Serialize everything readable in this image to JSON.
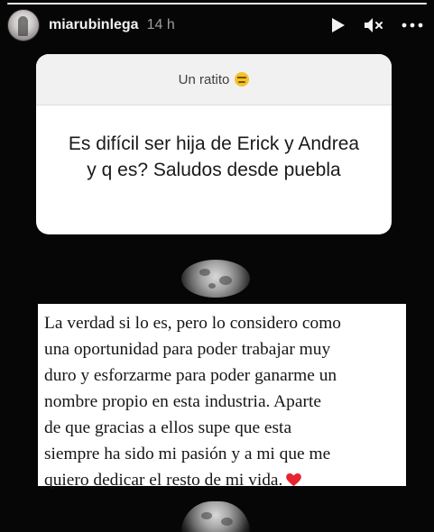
{
  "story": {
    "username": "miarubinlega",
    "time": "14 h",
    "progress": 1.0
  },
  "header": {
    "icons": [
      "play-icon",
      "mute-icon",
      "more-icon"
    ]
  },
  "question_sticker": {
    "prompt": "Un ratito",
    "prompt_emoji": "grimacing-face-emoji",
    "question": "Es difícil ser hija de Erick y Andrea y q es? Saludos desde puebla"
  },
  "answer": {
    "text": "La verdad si lo es, pero lo considero como\nuna oportunidad para poder trabajar muy\nduro y esforzarme para poder ganarme un\nnombre propio en esta industria. Aparte\nde que gracias a ellos supe que esta\nsiempre ha sido mi pasión y a mi que me\nquiero dedicar el resto de mi vida.",
    "emoji": "red-heart-emoji"
  },
  "colors": {
    "background": "#060606",
    "sticker_bg": "#ffffff",
    "sticker_header_bg": "#f1f1f1",
    "heart": "#e8222e"
  }
}
